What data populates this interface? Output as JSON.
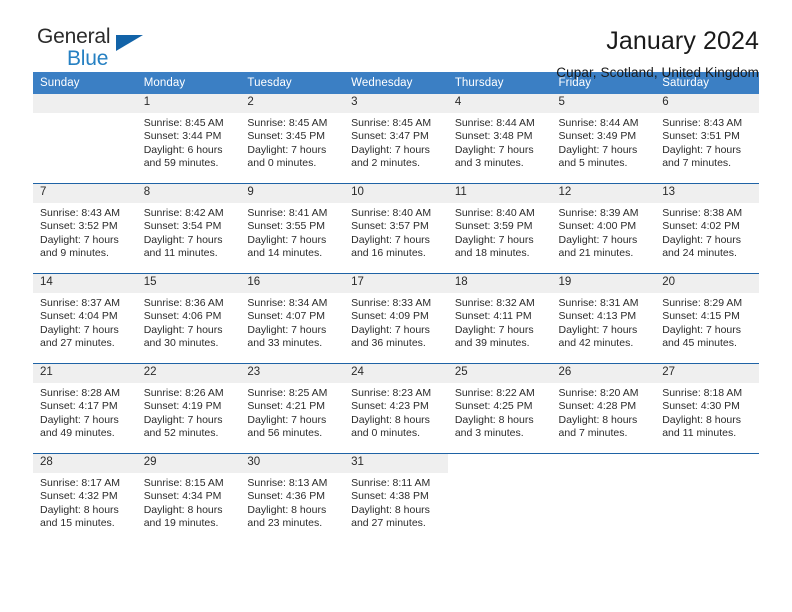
{
  "brand": {
    "word_one": "General",
    "word_two": "Blue",
    "flag_icon": "triangle-flag-icon"
  },
  "header": {
    "title": "January 2024",
    "subtitle": "Cupar, Scotland, United Kingdom"
  },
  "colors": {
    "header_blue": "#3b7fc4",
    "separator_blue": "#1f63a5",
    "daynum_band": "#efefef",
    "brand_blue": "#2680c2",
    "text": "#2b2b2b"
  },
  "labels": {
    "sunrise_prefix": "Sunrise:",
    "sunset_prefix": "Sunset:",
    "daylight_prefix": "Daylight:"
  },
  "weekday_headers": [
    "Sunday",
    "Monday",
    "Tuesday",
    "Wednesday",
    "Thursday",
    "Friday",
    "Saturday"
  ],
  "weeks": [
    [
      {
        "day": "",
        "empty": true
      },
      {
        "day": "1",
        "sunrise": "Sunrise: 8:45 AM",
        "sunset": "Sunset: 3:44 PM",
        "daylight_line1": "Daylight: 6 hours",
        "daylight_line2": "and 59 minutes."
      },
      {
        "day": "2",
        "sunrise": "Sunrise: 8:45 AM",
        "sunset": "Sunset: 3:45 PM",
        "daylight_line1": "Daylight: 7 hours",
        "daylight_line2": "and 0 minutes."
      },
      {
        "day": "3",
        "sunrise": "Sunrise: 8:45 AM",
        "sunset": "Sunset: 3:47 PM",
        "daylight_line1": "Daylight: 7 hours",
        "daylight_line2": "and 2 minutes."
      },
      {
        "day": "4",
        "sunrise": "Sunrise: 8:44 AM",
        "sunset": "Sunset: 3:48 PM",
        "daylight_line1": "Daylight: 7 hours",
        "daylight_line2": "and 3 minutes."
      },
      {
        "day": "5",
        "sunrise": "Sunrise: 8:44 AM",
        "sunset": "Sunset: 3:49 PM",
        "daylight_line1": "Daylight: 7 hours",
        "daylight_line2": "and 5 minutes."
      },
      {
        "day": "6",
        "sunrise": "Sunrise: 8:43 AM",
        "sunset": "Sunset: 3:51 PM",
        "daylight_line1": "Daylight: 7 hours",
        "daylight_line2": "and 7 minutes."
      }
    ],
    [
      {
        "day": "7",
        "sunrise": "Sunrise: 8:43 AM",
        "sunset": "Sunset: 3:52 PM",
        "daylight_line1": "Daylight: 7 hours",
        "daylight_line2": "and 9 minutes."
      },
      {
        "day": "8",
        "sunrise": "Sunrise: 8:42 AM",
        "sunset": "Sunset: 3:54 PM",
        "daylight_line1": "Daylight: 7 hours",
        "daylight_line2": "and 11 minutes."
      },
      {
        "day": "9",
        "sunrise": "Sunrise: 8:41 AM",
        "sunset": "Sunset: 3:55 PM",
        "daylight_line1": "Daylight: 7 hours",
        "daylight_line2": "and 14 minutes."
      },
      {
        "day": "10",
        "sunrise": "Sunrise: 8:40 AM",
        "sunset": "Sunset: 3:57 PM",
        "daylight_line1": "Daylight: 7 hours",
        "daylight_line2": "and 16 minutes."
      },
      {
        "day": "11",
        "sunrise": "Sunrise: 8:40 AM",
        "sunset": "Sunset: 3:59 PM",
        "daylight_line1": "Daylight: 7 hours",
        "daylight_line2": "and 18 minutes."
      },
      {
        "day": "12",
        "sunrise": "Sunrise: 8:39 AM",
        "sunset": "Sunset: 4:00 PM",
        "daylight_line1": "Daylight: 7 hours",
        "daylight_line2": "and 21 minutes."
      },
      {
        "day": "13",
        "sunrise": "Sunrise: 8:38 AM",
        "sunset": "Sunset: 4:02 PM",
        "daylight_line1": "Daylight: 7 hours",
        "daylight_line2": "and 24 minutes."
      }
    ],
    [
      {
        "day": "14",
        "sunrise": "Sunrise: 8:37 AM",
        "sunset": "Sunset: 4:04 PM",
        "daylight_line1": "Daylight: 7 hours",
        "daylight_line2": "and 27 minutes."
      },
      {
        "day": "15",
        "sunrise": "Sunrise: 8:36 AM",
        "sunset": "Sunset: 4:06 PM",
        "daylight_line1": "Daylight: 7 hours",
        "daylight_line2": "and 30 minutes."
      },
      {
        "day": "16",
        "sunrise": "Sunrise: 8:34 AM",
        "sunset": "Sunset: 4:07 PM",
        "daylight_line1": "Daylight: 7 hours",
        "daylight_line2": "and 33 minutes."
      },
      {
        "day": "17",
        "sunrise": "Sunrise: 8:33 AM",
        "sunset": "Sunset: 4:09 PM",
        "daylight_line1": "Daylight: 7 hours",
        "daylight_line2": "and 36 minutes."
      },
      {
        "day": "18",
        "sunrise": "Sunrise: 8:32 AM",
        "sunset": "Sunset: 4:11 PM",
        "daylight_line1": "Daylight: 7 hours",
        "daylight_line2": "and 39 minutes."
      },
      {
        "day": "19",
        "sunrise": "Sunrise: 8:31 AM",
        "sunset": "Sunset: 4:13 PM",
        "daylight_line1": "Daylight: 7 hours",
        "daylight_line2": "and 42 minutes."
      },
      {
        "day": "20",
        "sunrise": "Sunrise: 8:29 AM",
        "sunset": "Sunset: 4:15 PM",
        "daylight_line1": "Daylight: 7 hours",
        "daylight_line2": "and 45 minutes."
      }
    ],
    [
      {
        "day": "21",
        "sunrise": "Sunrise: 8:28 AM",
        "sunset": "Sunset: 4:17 PM",
        "daylight_line1": "Daylight: 7 hours",
        "daylight_line2": "and 49 minutes."
      },
      {
        "day": "22",
        "sunrise": "Sunrise: 8:26 AM",
        "sunset": "Sunset: 4:19 PM",
        "daylight_line1": "Daylight: 7 hours",
        "daylight_line2": "and 52 minutes."
      },
      {
        "day": "23",
        "sunrise": "Sunrise: 8:25 AM",
        "sunset": "Sunset: 4:21 PM",
        "daylight_line1": "Daylight: 7 hours",
        "daylight_line2": "and 56 minutes."
      },
      {
        "day": "24",
        "sunrise": "Sunrise: 8:23 AM",
        "sunset": "Sunset: 4:23 PM",
        "daylight_line1": "Daylight: 8 hours",
        "daylight_line2": "and 0 minutes."
      },
      {
        "day": "25",
        "sunrise": "Sunrise: 8:22 AM",
        "sunset": "Sunset: 4:25 PM",
        "daylight_line1": "Daylight: 8 hours",
        "daylight_line2": "and 3 minutes."
      },
      {
        "day": "26",
        "sunrise": "Sunrise: 8:20 AM",
        "sunset": "Sunset: 4:28 PM",
        "daylight_line1": "Daylight: 8 hours",
        "daylight_line2": "and 7 minutes."
      },
      {
        "day": "27",
        "sunrise": "Sunrise: 8:18 AM",
        "sunset": "Sunset: 4:30 PM",
        "daylight_line1": "Daylight: 8 hours",
        "daylight_line2": "and 11 minutes."
      }
    ],
    [
      {
        "day": "28",
        "sunrise": "Sunrise: 8:17 AM",
        "sunset": "Sunset: 4:32 PM",
        "daylight_line1": "Daylight: 8 hours",
        "daylight_line2": "and 15 minutes."
      },
      {
        "day": "29",
        "sunrise": "Sunrise: 8:15 AM",
        "sunset": "Sunset: 4:34 PM",
        "daylight_line1": "Daylight: 8 hours",
        "daylight_line2": "and 19 minutes."
      },
      {
        "day": "30",
        "sunrise": "Sunrise: 8:13 AM",
        "sunset": "Sunset: 4:36 PM",
        "daylight_line1": "Daylight: 8 hours",
        "daylight_line2": "and 23 minutes."
      },
      {
        "day": "31",
        "sunrise": "Sunrise: 8:11 AM",
        "sunset": "Sunset: 4:38 PM",
        "daylight_line1": "Daylight: 8 hours",
        "daylight_line2": "and 27 minutes."
      },
      {
        "day": "",
        "blank": true
      },
      {
        "day": "",
        "blank": true
      },
      {
        "day": "",
        "blank": true
      }
    ]
  ]
}
